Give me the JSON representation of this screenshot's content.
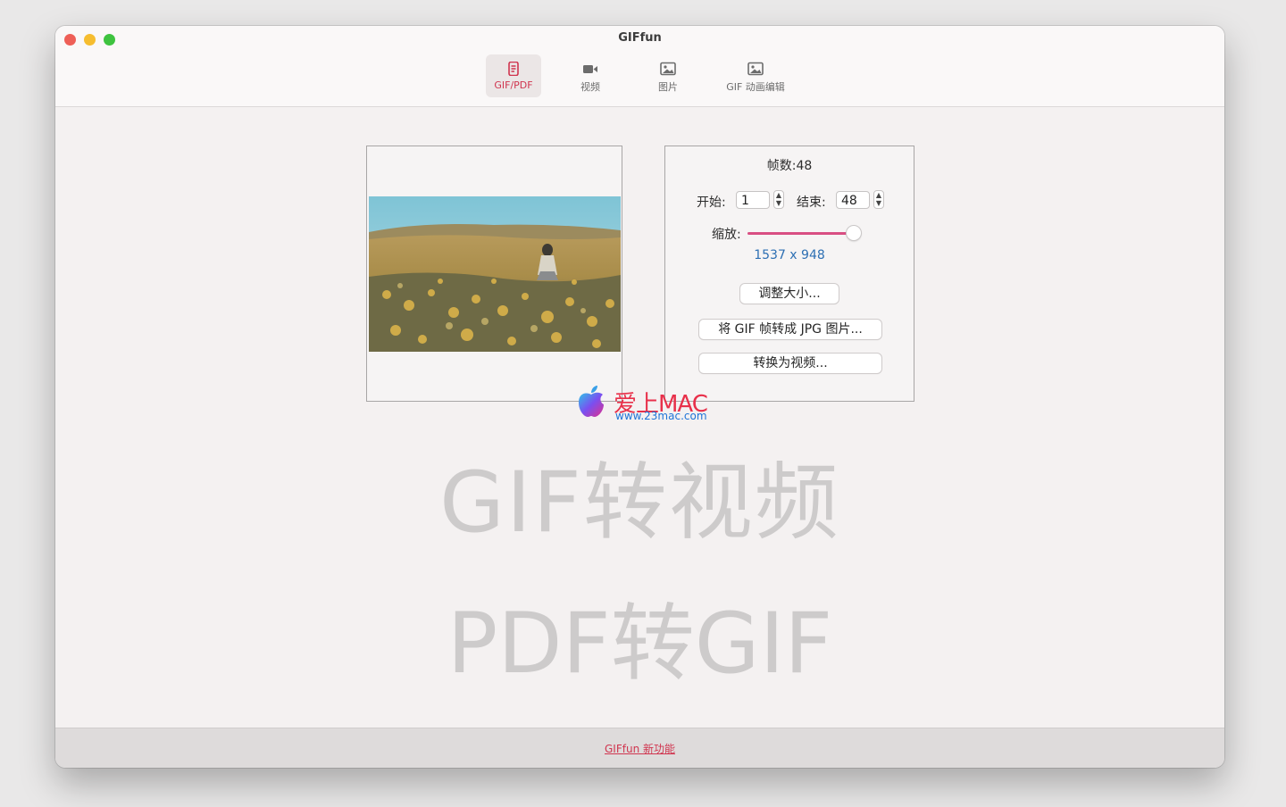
{
  "window": {
    "title": "GIFfun"
  },
  "tabs": [
    {
      "label": "GIF/PDF",
      "icon": "document-icon",
      "active": true
    },
    {
      "label": "视频",
      "icon": "video-camera-icon",
      "active": false
    },
    {
      "label": "图片",
      "icon": "image-icon",
      "active": false
    },
    {
      "label": "GIF 动画编辑",
      "icon": "image-edit-icon",
      "active": false
    }
  ],
  "panel": {
    "frames_label": "帧数:48",
    "start_label": "开始:",
    "start_value": "1",
    "end_label": "结束:",
    "end_value": "48",
    "zoom_label": "缩放:",
    "zoom_level": 1.0,
    "dimensions": "1537 x 948",
    "resize_button": "调整大小...",
    "to_jpg_button": "将 GIF 帧转成 JPG 图片...",
    "to_video_button": "转换为视频..."
  },
  "watermark": {
    "brand": "爱上MAC",
    "url": "www.23mac.com",
    "line1": "GIF转视频",
    "line2": "PDF转GIF"
  },
  "footer": {
    "link": "GIFfun 新功能"
  },
  "colors": {
    "accent": "#d0354f",
    "slider": "#d94f83",
    "dimensions": "#2d6fb3"
  }
}
